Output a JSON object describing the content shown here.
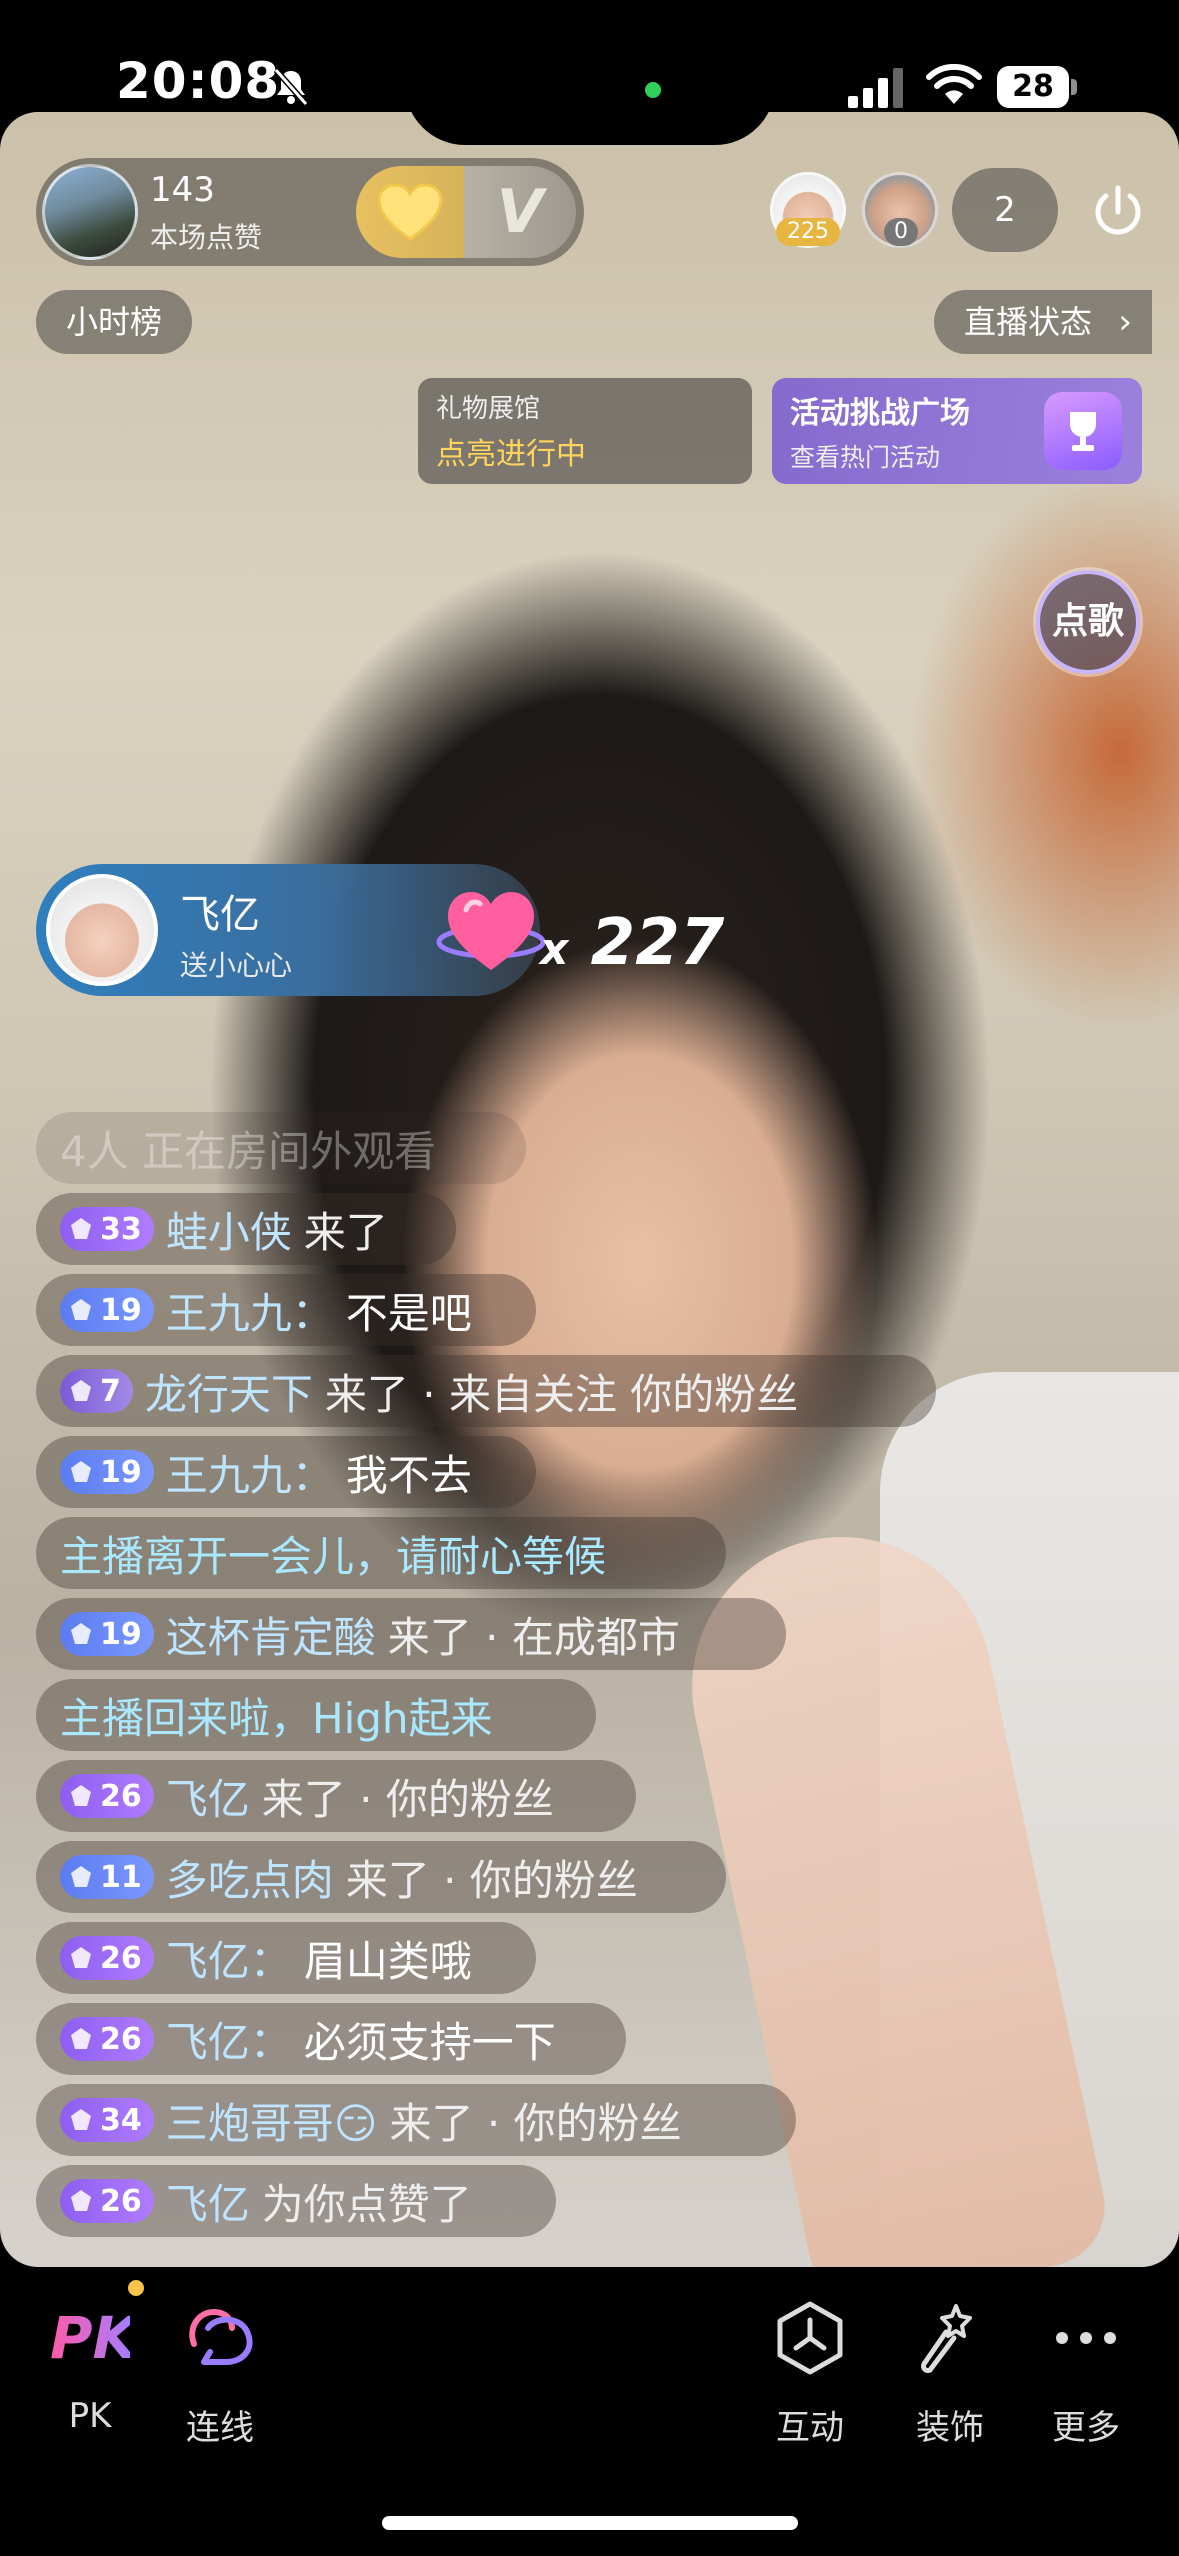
{
  "status_bar": {
    "time": "20:08",
    "battery": "28"
  },
  "anchor": {
    "likes": "143",
    "likes_label": "本场点赞"
  },
  "viewers": [
    {
      "badge": "225",
      "badge_color": "#e8b640"
    },
    {
      "badge": "0",
      "badge_color": "#777777"
    }
  ],
  "viewer_count": "2",
  "chips": {
    "hour_rank": "小时榜",
    "live_status": "直播状态",
    "chevron": "›"
  },
  "gift_gallery": {
    "title": "礼物展馆",
    "subtitle": "点亮进行中"
  },
  "activity": {
    "title": "活动挑战广场",
    "subtitle": "查看热门活动"
  },
  "song_button": "点歌",
  "gift_banner": {
    "user": "飞亿",
    "action": "送小心心",
    "multiplier_prefix": "x",
    "count": "227"
  },
  "chat": [
    {
      "type": "watchers",
      "text": "4人 正在房间外观看"
    },
    {
      "type": "enter",
      "level": "33",
      "tier": "purple",
      "user": "蛙小侠",
      "meta": "来了"
    },
    {
      "type": "message",
      "level": "19",
      "tier": "blue",
      "user": "王九九：",
      "text": "不是吧"
    },
    {
      "type": "enter",
      "level": "7",
      "tier": "violet",
      "user": "龙行天下",
      "meta": "来了 · 来自关注 你的粉丝"
    },
    {
      "type": "message",
      "level": "19",
      "tier": "blue",
      "user": "王九九：",
      "text": "我不去"
    },
    {
      "type": "system",
      "text": "主播离开一会儿，请耐心等候"
    },
    {
      "type": "enter",
      "level": "19",
      "tier": "blue",
      "user": "这杯肯定酸",
      "meta": "来了 · 在成都市"
    },
    {
      "type": "system",
      "text": "主播回来啦，High起来"
    },
    {
      "type": "enter",
      "level": "26",
      "tier": "purple",
      "user": "飞亿",
      "meta": "来了 · 你的粉丝"
    },
    {
      "type": "enter",
      "level": "11",
      "tier": "blue",
      "user": "多吃点肉",
      "meta": "来了 · 你的粉丝"
    },
    {
      "type": "message",
      "level": "26",
      "tier": "purple",
      "user": "飞亿：",
      "text": "眉山类哦"
    },
    {
      "type": "message",
      "level": "26",
      "tier": "purple",
      "user": "飞亿：",
      "text": "必须支持一下"
    },
    {
      "type": "enter",
      "level": "34",
      "tier": "purple",
      "user": "三炮哥哥😏",
      "meta": "来了 · 你的粉丝"
    },
    {
      "type": "enter",
      "level": "26",
      "tier": "purple",
      "user": "飞亿",
      "meta": "为你点赞了"
    }
  ],
  "bottom_tabs": {
    "pk_icon": "PK",
    "pk": "PK",
    "link": "连线",
    "interact": "互动",
    "decorate": "装饰",
    "more": "更多"
  }
}
